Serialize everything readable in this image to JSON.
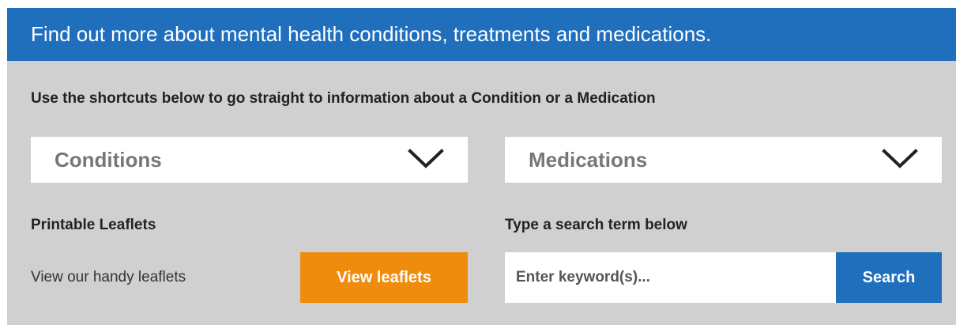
{
  "banner": {
    "title": "Find out more about mental health conditions, treatments and medications."
  },
  "intro": {
    "text": "Use the shortcuts below to go straight to information about a Condition or a Medication"
  },
  "dropdowns": {
    "conditions": {
      "label": "Conditions",
      "icon": "chevron-down-icon"
    },
    "medications": {
      "label": "Medications",
      "icon": "chevron-down-icon"
    }
  },
  "leaflets": {
    "heading": "Printable Leaflets",
    "text": "View our handy leaflets",
    "button_label": "View leaflets"
  },
  "search": {
    "heading": "Type a search term below",
    "placeholder": "Enter keyword(s)...",
    "value": "",
    "button_label": "Search"
  },
  "colors": {
    "banner_blue": "#1f6fbd",
    "panel_grey": "#d0d0d0",
    "leaflet_orange": "#ef8c0e"
  }
}
